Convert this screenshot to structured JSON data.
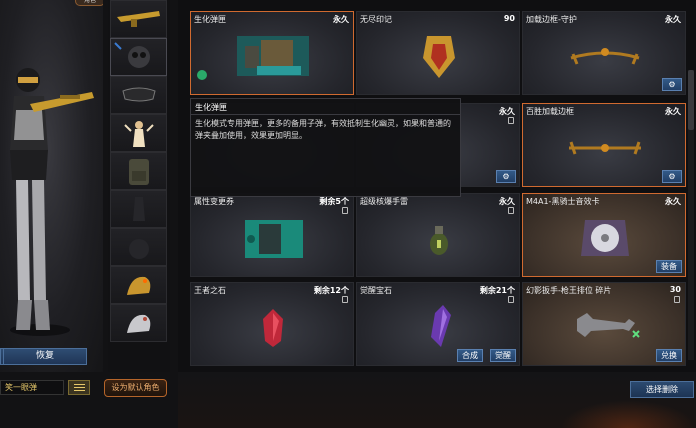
{
  "character": {
    "role_tag": "角色",
    "restore_label": "恢复",
    "name_value": "笑一眼弹",
    "set_default_label": "设为默认角色"
  },
  "equipment_slots": [
    {
      "icon": "rifle-icon"
    },
    {
      "icon": "skull-mask-icon"
    },
    {
      "icon": "goggles-icon"
    },
    {
      "icon": "angel-figure-icon"
    },
    {
      "icon": "backpack-icon"
    },
    {
      "icon": "grenade-slot-empty-icon"
    },
    {
      "icon": "grenade-slot-empty-icon"
    },
    {
      "icon": "gold-dragon-icon"
    },
    {
      "icon": "silver-dragon-icon"
    }
  ],
  "items": [
    {
      "name": "生化弹匣",
      "duration": "永久",
      "art": "ammo-crate-icon",
      "selected": true
    },
    {
      "name": "无尽印记",
      "duration": "90",
      "art": "gold-badge-icon"
    },
    {
      "name": "加载边框-守护",
      "duration": "永久",
      "art": "gold-frame-icon",
      "button": "gear"
    },
    {
      "name": "",
      "duration": "永久",
      "art": "",
      "button": "gear"
    },
    {
      "name": "",
      "duration": "永久",
      "art": ""
    },
    {
      "name": "百胜加载边框",
      "duration": "永久",
      "art": "gold-frame-icon",
      "button": "gear"
    },
    {
      "name": "属性变更券",
      "duration": "剩余5个",
      "art": "ticket-icon"
    },
    {
      "name": "超级核爆手雷",
      "duration": "永久",
      "art": "grenade-icon"
    },
    {
      "name": "M4A1-黑骑士音效卡",
      "duration": "永久",
      "art": "sound-card-icon",
      "button": "装备"
    },
    {
      "name": "王者之石",
      "duration": "剩余12个",
      "art": "red-gem-icon"
    },
    {
      "name": "觉醒宝石",
      "duration": "剩余21个",
      "art": "purple-gem-icon",
      "buttons": [
        "合成",
        "觉醒"
      ]
    },
    {
      "name": "幻影扳手-枪王排位 碎片",
      "duration": "30",
      "art": "wrench-icon",
      "button": "兑换"
    }
  ],
  "tooltip": {
    "title": "生化弹匣",
    "description": "生化模式专用弹匣，更多的备用子弹，有效抵制生化幽灵，如果和普通的弹夹叠加使用，效果更加明显。"
  },
  "bottom": {
    "delete_label": "选择删除"
  },
  "colors": {
    "accent_orange": "#d06a30",
    "button_blue": "#2c4a70",
    "gold": "#e6c86a"
  }
}
